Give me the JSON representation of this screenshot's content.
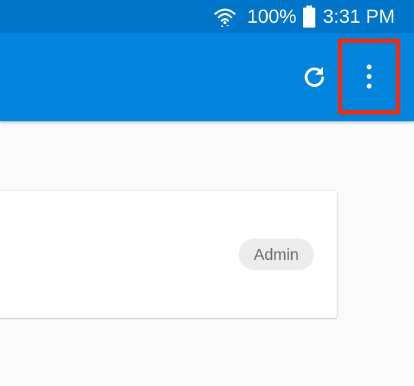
{
  "status_bar": {
    "battery_percent": "100%",
    "time": "3:31 PM",
    "wifi_icon": "wifi-icon",
    "battery_icon": "battery-full-icon"
  },
  "app_bar": {
    "actions": [
      {
        "icon": "refresh-icon"
      },
      {
        "icon": "more-vert-icon"
      }
    ],
    "highlight_color": "#f22a10"
  },
  "card": {
    "role_chip": "Admin"
  },
  "colors": {
    "status_bar": "#0175c9",
    "app_bar": "#0284dc",
    "background": "#fafafa",
    "chip_background": "#ececec"
  }
}
